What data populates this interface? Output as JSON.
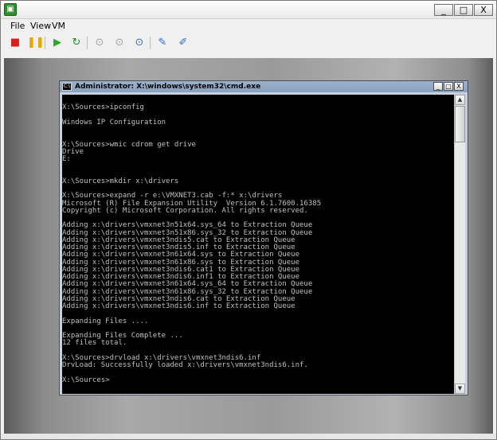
{
  "vm_window": {
    "icon_glyph": "▣",
    "buttons": {
      "minimize": "_",
      "maximize": "□",
      "close": "X"
    }
  },
  "menu": {
    "items": [
      "File",
      "View",
      "VM"
    ]
  },
  "toolbar": {
    "icons": [
      {
        "name": "stop-icon",
        "glyph": "■",
        "color": "#d62020"
      },
      {
        "name": "pause-icon",
        "glyph": "❚❚",
        "color": "#e6a800"
      },
      {
        "name": "play-icon",
        "glyph": "▶",
        "color": "#2aa52a"
      },
      {
        "name": "reset-icon",
        "glyph": "↻",
        "color": "#1f8a2a"
      },
      {
        "name": "snapshot-icon",
        "glyph": "⊙",
        "color": "#a0a0a0"
      },
      {
        "name": "revert-snapshot-icon",
        "glyph": "⊙",
        "color": "#a0a0a0"
      },
      {
        "name": "snapshot-manager-icon",
        "glyph": "⊙",
        "color": "#3a6fb0"
      },
      {
        "name": "settings-icon",
        "glyph": "✎",
        "color": "#2f6fb8"
      },
      {
        "name": "tools-icon",
        "glyph": "✐",
        "color": "#2f6fb8"
      }
    ]
  },
  "cmd_window": {
    "title": "Administrator: X:\\windows\\system32\\cmd.exe",
    "icon_text": "C:\\",
    "buttons": {
      "minimize": "_",
      "maximize": "□",
      "close": "X"
    }
  },
  "console": {
    "lines": [
      "",
      "X:\\Sources>ipconfig",
      "",
      "Windows IP Configuration",
      "",
      "",
      "X:\\Sources>wmic cdrom get drive",
      "Drive",
      "E:",
      "",
      "",
      "X:\\Sources>mkdir x:\\drivers",
      "",
      "X:\\Sources>expand -r e:\\VMXNET3.cab -f:* x:\\drivers",
      "Microsoft (R) File Expansion Utility  Version 6.1.7600.16385",
      "Copyright (c) Microsoft Corporation. All rights reserved.",
      "",
      "Adding x:\\drivers\\vmxnet3n51x64.sys_64 to Extraction Queue",
      "Adding x:\\drivers\\vmxnet3n51x86.sys_32 to Extraction Queue",
      "Adding x:\\drivers\\vmxnet3ndis5.cat to Extraction Queue",
      "Adding x:\\drivers\\vmxnet3ndis5.inf to Extraction Queue",
      "Adding x:\\drivers\\vmxnet3n61x64.sys to Extraction Queue",
      "Adding x:\\drivers\\vmxnet3n61x86.sys to Extraction Queue",
      "Adding x:\\drivers\\vmxnet3ndis6.cat1 to Extraction Queue",
      "Adding x:\\drivers\\vmxnet3ndis6.inf1 to Extraction Queue",
      "Adding x:\\drivers\\vmxnet3n61x64.sys_64 to Extraction Queue",
      "Adding x:\\drivers\\vmxnet3n61x86.sys_32 to Extraction Queue",
      "Adding x:\\drivers\\vmxnet3ndis6.cat to Extraction Queue",
      "Adding x:\\drivers\\vmxnet3ndis6.inf to Extraction Queue",
      "",
      "Expanding Files ....",
      "",
      "Expanding Files Complete ...",
      "12 files total.",
      "",
      "X:\\Sources>drvload x:\\drivers\\vmxnet3ndis6.inf",
      "DrvLoad: Successfully loaded x:\\drivers\\vmxnet3ndis6.inf.",
      "",
      "X:\\Sources>"
    ]
  },
  "scrollbar": {
    "up_glyph": "▲",
    "down_glyph": "▼"
  }
}
